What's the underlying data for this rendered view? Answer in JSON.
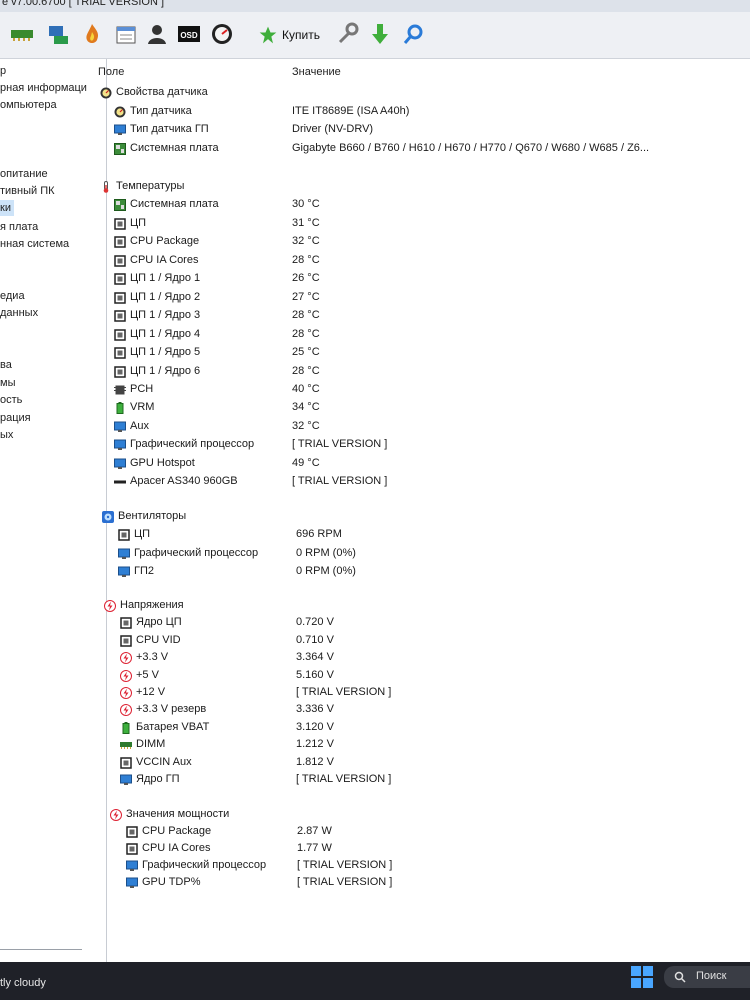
{
  "window": {
    "title": "e v7.00.6700  [ TRIAL VERSION ]"
  },
  "toolbar": {
    "buy_label": "Купить"
  },
  "sidebar": {
    "items": [
      "р",
      "рная информаци",
      "омпьютера",
      "опитание",
      "тивный ПК",
      "ки",
      "я плата",
      "нная система",
      "едиа",
      " данных",
      "ва",
      "мы",
      "ость",
      "рация",
      "ых"
    ]
  },
  "columns": {
    "field": "Поле",
    "value": "Значение"
  },
  "sensor_props": {
    "title": "Свойства датчика",
    "rows": [
      {
        "label": "Тип датчика",
        "value": "ITE IT8689E  (ISA A40h)"
      },
      {
        "label": "Тип датчика ГП",
        "value": "Driver  (NV-DRV)"
      },
      {
        "label": "Системная плата",
        "value": "Gigabyte B660 / B760 / H610 / H670 / H770 / Q670 / W680 / W685 / Z6..."
      }
    ]
  },
  "temperatures": {
    "title": "Температуры",
    "rows": [
      {
        "label": "Системная плата",
        "value": "30 °C"
      },
      {
        "label": "ЦП",
        "value": "31 °C"
      },
      {
        "label": "CPU Package",
        "value": "32 °C"
      },
      {
        "label": "CPU IA Cores",
        "value": "28 °C"
      },
      {
        "label": "ЦП 1 / Ядро 1",
        "value": "26 °C"
      },
      {
        "label": "ЦП 1 / Ядро 2",
        "value": "27 °C"
      },
      {
        "label": "ЦП 1 / Ядро 3",
        "value": "28 °C"
      },
      {
        "label": "ЦП 1 / Ядро 4",
        "value": "28 °C"
      },
      {
        "label": "ЦП 1 / Ядро 5",
        "value": "25 °C"
      },
      {
        "label": "ЦП 1 / Ядро 6",
        "value": "28 °C"
      },
      {
        "label": "PCH",
        "value": "40 °C"
      },
      {
        "label": "VRM",
        "value": "34 °C"
      },
      {
        "label": "Aux",
        "value": "32 °C"
      },
      {
        "label": "Графический процессор",
        "value": "[ TRIAL VERSION ]"
      },
      {
        "label": "GPU Hotspot",
        "value": "49 °C"
      },
      {
        "label": "Apacer AS340 960GB",
        "value": "[ TRIAL VERSION ]"
      }
    ]
  },
  "fans": {
    "title": "Вентиляторы",
    "rows": [
      {
        "label": "ЦП",
        "value": "696 RPM"
      },
      {
        "label": "Графический процессор",
        "value": "0 RPM  (0%)"
      },
      {
        "label": "ГП2",
        "value": "0 RPM  (0%)"
      }
    ]
  },
  "voltages": {
    "title": "Напряжения",
    "rows": [
      {
        "label": "Ядро ЦП",
        "value": "0.720 V"
      },
      {
        "label": "CPU VID",
        "value": "0.710 V"
      },
      {
        "label": "+3.3 V",
        "value": "3.364 V"
      },
      {
        "label": "+5 V",
        "value": "5.160 V"
      },
      {
        "label": "+12 V",
        "value": "[ TRIAL VERSION ]"
      },
      {
        "label": "+3.3 V резерв",
        "value": "3.336 V"
      },
      {
        "label": "Батарея VBAT",
        "value": "3.120 V"
      },
      {
        "label": "DIMM",
        "value": "1.212 V"
      },
      {
        "label": "VCCIN Aux",
        "value": "1.812 V"
      },
      {
        "label": "Ядро ГП",
        "value": "[ TRIAL VERSION ]"
      }
    ]
  },
  "power": {
    "title": "Значения мощности",
    "rows": [
      {
        "label": "CPU Package",
        "value": "2.87 W"
      },
      {
        "label": "CPU IA Cores",
        "value": "1.77 W"
      },
      {
        "label": "Графический процессор",
        "value": "[ TRIAL VERSION ]"
      },
      {
        "label": "GPU TDP%",
        "value": "[ TRIAL VERSION ]"
      }
    ]
  },
  "taskbar": {
    "weather": "tly cloudy",
    "search": "Поиск"
  },
  "colors": {
    "accent": "#1e6fd9",
    "window_bg": "#ffffff",
    "toolbar_bg": "#eef0f4",
    "taskbar_bg": "#1f2128"
  }
}
